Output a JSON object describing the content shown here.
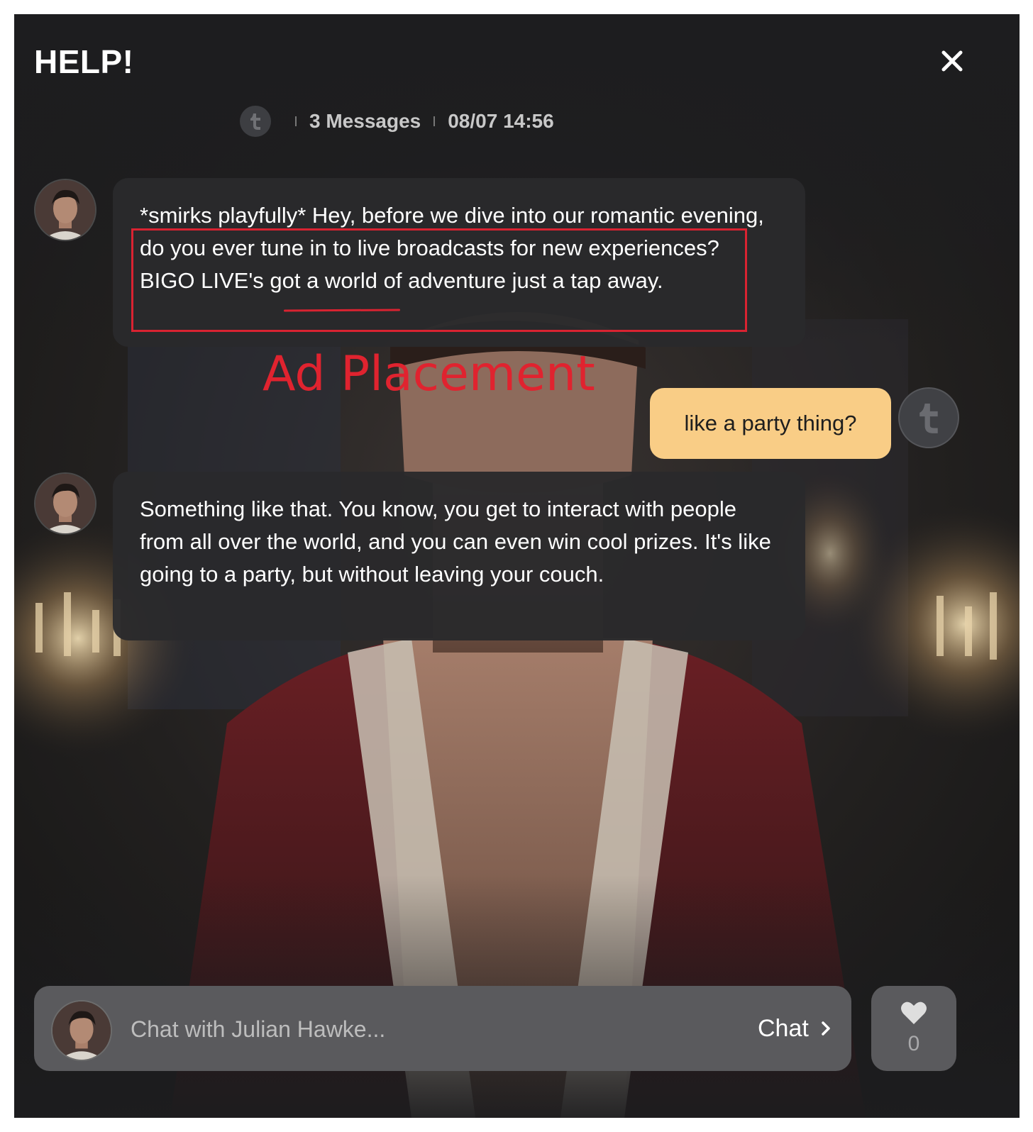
{
  "dialog": {
    "title": "HELP!",
    "close_icon": "close-icon"
  },
  "meta": {
    "messages": "3 Messages",
    "timestamp": "08/07 14:56"
  },
  "messages": [
    {
      "sender": "bot",
      "text": "*smirks playfully* Hey, before we dive into our romantic evening, do you ever tune in to live broadcasts for new experiences? BIGO LIVE's got a world of adventure just a tap away."
    },
    {
      "sender": "user",
      "text": "like a party thing?"
    },
    {
      "sender": "bot",
      "text": "Something like that. You know, you get to interact with people from all over the world, and you can even win cool prizes. It's like going to a party, but without leaving your couch."
    }
  ],
  "annotation": {
    "label": "Ad Placement",
    "color": "#d92331"
  },
  "input": {
    "placeholder": "Chat with Julian Hawke...",
    "send_label": "Chat"
  },
  "likes": {
    "count": "0",
    "icon": "heart-icon"
  },
  "colors": {
    "user_bubble": "#f9cd86",
    "bot_bubble": "#2a2a2c",
    "panel": "#1d1d1f"
  }
}
